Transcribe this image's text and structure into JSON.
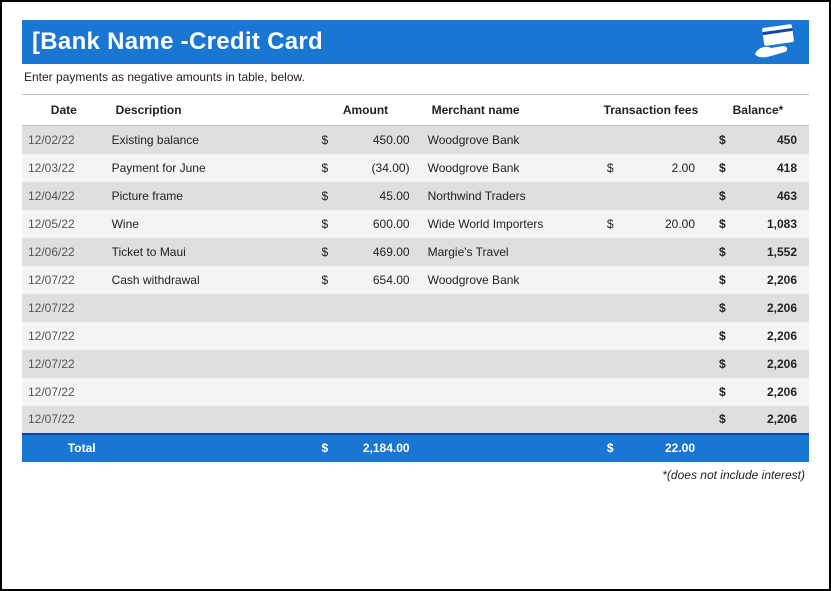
{
  "header": {
    "title": "[Bank Name -Credit Card",
    "icon": "credit-card-hand-icon"
  },
  "instructions": "Enter payments as negative amounts in table, below.",
  "columns": {
    "date": "Date",
    "description": "Description",
    "amount": "Amount",
    "merchant": "Merchant name",
    "fees": "Transaction fees",
    "balance": "Balance*"
  },
  "currency": "$",
  "rows": [
    {
      "date": "12/02/22",
      "description": "Existing balance",
      "amount": "450.00",
      "merchant": "Woodgrove Bank",
      "fees": "",
      "balance": "450"
    },
    {
      "date": "12/03/22",
      "description": "Payment for June",
      "amount": "(34.00)",
      "merchant": "Woodgrove Bank",
      "fees": "2.00",
      "balance": "418"
    },
    {
      "date": "12/04/22",
      "description": "Picture frame",
      "amount": "45.00",
      "merchant": "Northwind Traders",
      "fees": "",
      "balance": "463"
    },
    {
      "date": "12/05/22",
      "description": "Wine",
      "amount": "600.00",
      "merchant": "Wide World Importers",
      "fees": "20.00",
      "balance": "1,083"
    },
    {
      "date": "12/06/22",
      "description": "Ticket to Maui",
      "amount": "469.00",
      "merchant": "Margie's Travel",
      "fees": "",
      "balance": "1,552"
    },
    {
      "date": "12/07/22",
      "description": "Cash withdrawal",
      "amount": "654.00",
      "merchant": "Woodgrove Bank",
      "fees": "",
      "balance": "2,206"
    },
    {
      "date": "12/07/22",
      "description": "",
      "amount": "",
      "merchant": "",
      "fees": "",
      "balance": "2,206"
    },
    {
      "date": "12/07/22",
      "description": "",
      "amount": "",
      "merchant": "",
      "fees": "",
      "balance": "2,206"
    },
    {
      "date": "12/07/22",
      "description": "",
      "amount": "",
      "merchant": "",
      "fees": "",
      "balance": "2,206"
    },
    {
      "date": "12/07/22",
      "description": "",
      "amount": "",
      "merchant": "",
      "fees": "",
      "balance": "2,206"
    },
    {
      "date": "12/07/22",
      "description": "",
      "amount": "",
      "merchant": "",
      "fees": "",
      "balance": "2,206"
    }
  ],
  "totals": {
    "label": "Total",
    "amount": "2,184.00",
    "fees": "22.00"
  },
  "footnote": "*(does not include interest)"
}
